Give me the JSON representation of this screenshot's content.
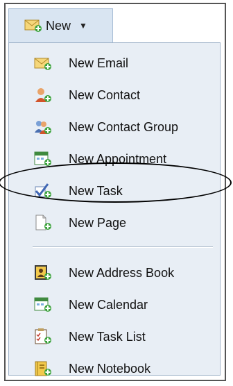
{
  "toolbar": {
    "new_label": "New",
    "new_icon": "new-email-icon",
    "caret": "▼"
  },
  "menu": {
    "items": [
      {
        "label": "New Email",
        "icon": "email-icon"
      },
      {
        "label": "New Contact",
        "icon": "contact-icon"
      },
      {
        "label": "New Contact Group",
        "icon": "contact-group-icon"
      },
      {
        "label": "New Appointment",
        "icon": "appointment-icon"
      },
      {
        "label": "New Task",
        "icon": "task-icon"
      },
      {
        "label": "New Page",
        "icon": "page-icon"
      },
      {
        "label": "New Address Book",
        "icon": "address-book-icon"
      },
      {
        "label": "New Calendar",
        "icon": "calendar-icon"
      },
      {
        "label": "New Task List",
        "icon": "task-list-icon"
      },
      {
        "label": "New Notebook",
        "icon": "notebook-icon"
      }
    ]
  },
  "colors": {
    "menu_bg": "#e8eef5",
    "button_bg": "#d9e5f2",
    "plus_green": "#3aa23a"
  }
}
